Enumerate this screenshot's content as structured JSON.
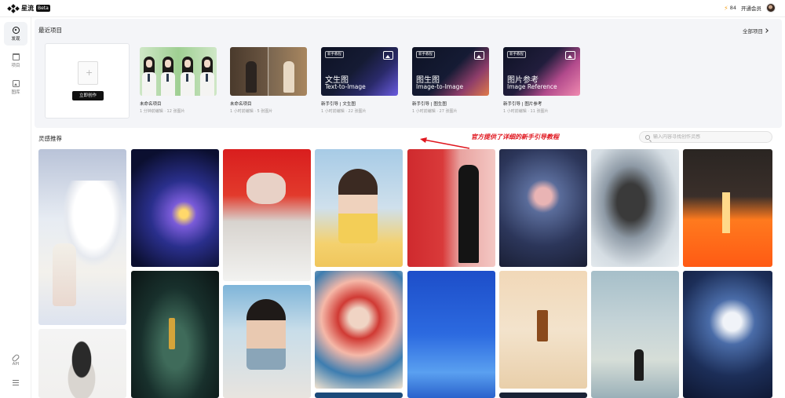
{
  "app": {
    "name": "星流",
    "badge": "Beta"
  },
  "topbar": {
    "credits": "84",
    "vip_label": "开通会员"
  },
  "sidebar": {
    "items": [
      {
        "label": "发现",
        "icon": "compass-icon"
      },
      {
        "label": "项目",
        "icon": "folder-icon"
      },
      {
        "label": "图库",
        "icon": "image-icon"
      },
      {
        "label": "API",
        "icon": "link-icon"
      },
      {
        "label": "",
        "icon": "menu-icon"
      }
    ]
  },
  "recent": {
    "title": "最近项目",
    "all_label": "全部项目",
    "new_button": "立即创作",
    "projects": [
      {
        "name": "未命名项目",
        "meta": "1 分钟前编辑 · 12 张图片"
      },
      {
        "name": "未命名项目",
        "meta": "1 小时前编辑 · 5 张图片"
      },
      {
        "name": "新手引导 | 文生图",
        "meta": "1 小时前编辑 · 22 张图片",
        "tag": "新手教程",
        "cn": "文生图",
        "en": "Text-to-Image"
      },
      {
        "name": "新手引导 | 图生图",
        "meta": "1 小时前编辑 · 27 张图片",
        "tag": "新手教程",
        "cn": "图生图",
        "en": "Image-to-Image"
      },
      {
        "name": "新手引导 | 图片参考",
        "meta": "1 小时前编辑 · 11 张图片",
        "tag": "新手教程",
        "cn": "图片参考",
        "en": "Image Reference"
      }
    ]
  },
  "annotation": {
    "text": "官方提供了详细的新手引导教程",
    "color": "#e0161e"
  },
  "inspiration": {
    "title": "灵感推荐",
    "search_placeholder": "输入内容寻找创作灵感"
  },
  "colors": {
    "accent": "#111111",
    "panel_bg": "#f4f5f8"
  }
}
